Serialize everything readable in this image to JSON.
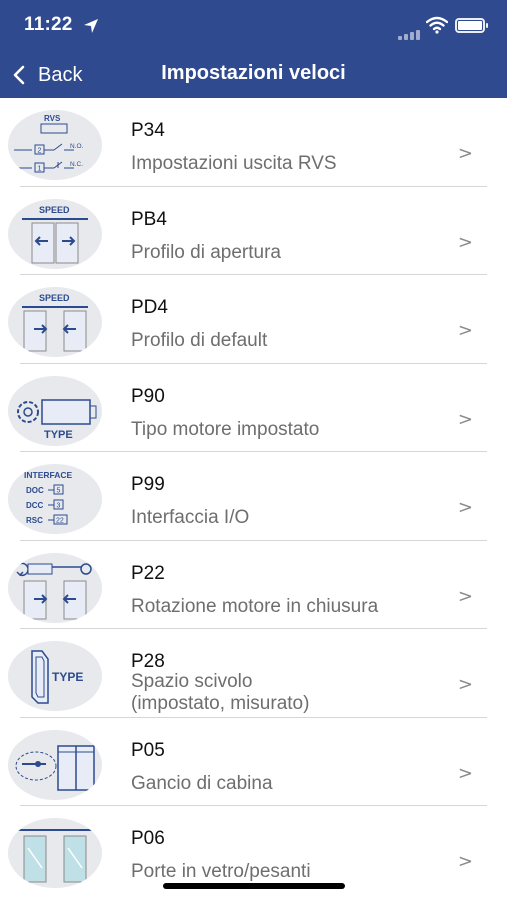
{
  "status_bar": {
    "time": "11:22"
  },
  "nav": {
    "back_label": "Back",
    "title": "Impostazioni veloci"
  },
  "items": [
    {
      "code": "P34",
      "description": "Impostazioni uscita RVS",
      "icon": "rvs-output-icon",
      "icon_text": [
        "RVS",
        "N.O.",
        "N.C.",
        "2",
        "1"
      ]
    },
    {
      "code": "PB4",
      "description": "Profilo di apertura",
      "icon": "speed-opening-icon",
      "icon_text": [
        "SPEED"
      ]
    },
    {
      "code": "PD4",
      "description": "Profilo di default",
      "icon": "speed-default-icon",
      "icon_text": [
        "SPEED"
      ]
    },
    {
      "code": "P90",
      "description": "Tipo motore impostato",
      "icon": "motor-type-icon",
      "icon_text": [
        "TYPE"
      ]
    },
    {
      "code": "P99",
      "description": "Interfaccia I/O",
      "icon": "interface-icon",
      "icon_text": [
        "INTERFACE",
        "DOC",
        "DCC",
        "RSC",
        "5",
        "3",
        "22"
      ]
    },
    {
      "code": "P22",
      "description": "Rotazione motore in chiusura",
      "icon": "motor-rotation-icon",
      "icon_text": []
    },
    {
      "code": "P28",
      "description": "Spazio scivolo\n(impostato, misurato)",
      "icon": "skate-type-icon",
      "icon_text": [
        "TYPE"
      ]
    },
    {
      "code": "P05",
      "description": "Gancio di cabina",
      "icon": "cabin-hook-icon",
      "icon_text": []
    },
    {
      "code": "P06",
      "description": "Porte in vetro/pesanti",
      "icon": "glass-doors-icon",
      "icon_text": []
    }
  ],
  "chevron": ">",
  "colors": {
    "header": "#2f4a8f",
    "icon_blue": "#2c4b8e",
    "thumb_bg": "#e8e9ed"
  }
}
